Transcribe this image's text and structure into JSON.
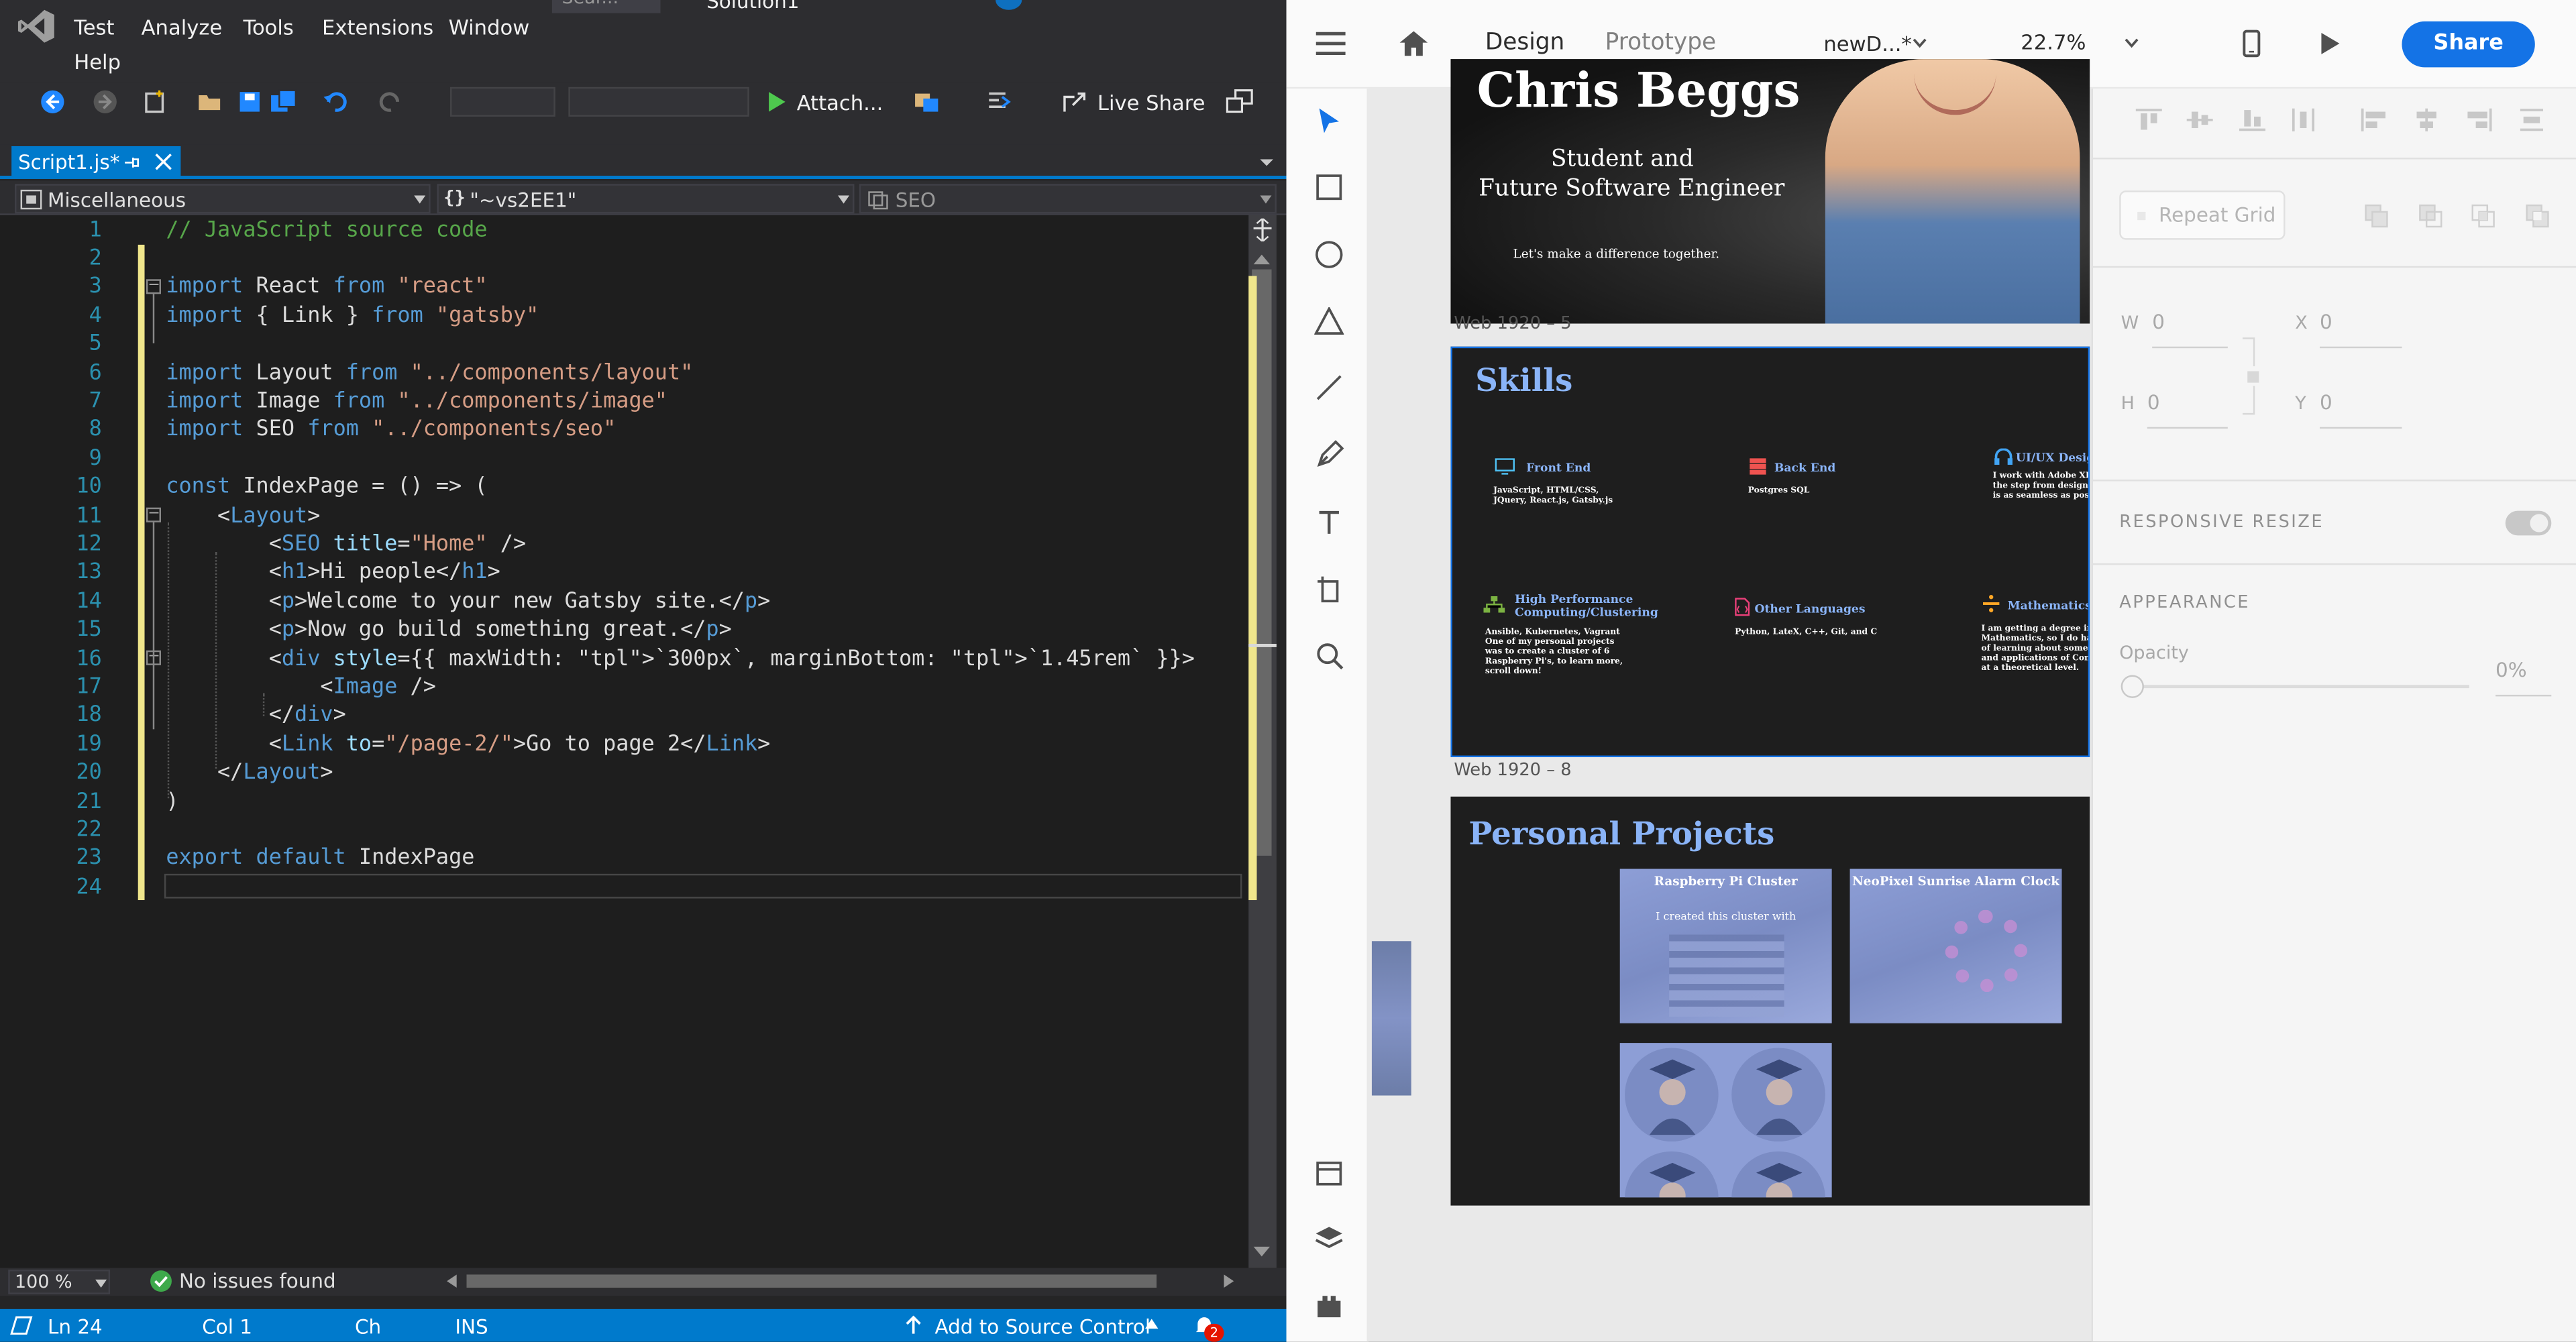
{
  "vs": {
    "menu": [
      "Test",
      "Analyze",
      "Tools",
      "Extensions",
      "Window",
      "Help"
    ],
    "search_placeholder": "Sear...",
    "solution_label": "Solution1",
    "attach_label": "Attach...",
    "live_share_label": "Live Share",
    "tab_title": "Script1.js*",
    "nav_project": "Miscellaneous",
    "nav_scope": "\"~vs2EE1\"",
    "nav_member": "SEO",
    "zoom": "100 %",
    "issues": "No issues found",
    "status": {
      "ln": "Ln 24",
      "col": "Col 1",
      "ch": "Ch",
      "ins": "INS",
      "source_control": "Add to Source Control",
      "notifications": "2"
    },
    "code_lines": [
      {
        "n": "1",
        "t": "// JavaScript source code"
      },
      {
        "n": "2",
        "t": ""
      },
      {
        "n": "3",
        "t": "import React from \"react\""
      },
      {
        "n": "4",
        "t": "import { Link } from \"gatsby\""
      },
      {
        "n": "5",
        "t": ""
      },
      {
        "n": "6",
        "t": "import Layout from \"../components/layout\""
      },
      {
        "n": "7",
        "t": "import Image from \"../components/image\""
      },
      {
        "n": "8",
        "t": "import SEO from \"../components/seo\""
      },
      {
        "n": "9",
        "t": ""
      },
      {
        "n": "10",
        "t": "const IndexPage = () => ("
      },
      {
        "n": "11",
        "t": "    <Layout>"
      },
      {
        "n": "12",
        "t": "        <SEO title=\"Home\" />"
      },
      {
        "n": "13",
        "t": "        <h1>Hi people</h1>"
      },
      {
        "n": "14",
        "t": "        <p>Welcome to your new Gatsby site.</p>"
      },
      {
        "n": "15",
        "t": "        <p>Now go build something great.</p>"
      },
      {
        "n": "16",
        "t": "        <div style={{ maxWidth: `300px`, marginBottom: `1.45rem` }}>"
      },
      {
        "n": "17",
        "t": "            <Image />"
      },
      {
        "n": "18",
        "t": "        </div>"
      },
      {
        "n": "19",
        "t": "        <Link to=\"/page-2/\">Go to page 2</Link>"
      },
      {
        "n": "20",
        "t": "    </Layout>"
      },
      {
        "n": "21",
        "t": ")"
      },
      {
        "n": "22",
        "t": ""
      },
      {
        "n": "23",
        "t": "export default IndexPage"
      },
      {
        "n": "24",
        "t": ""
      }
    ]
  },
  "xd": {
    "tabs": {
      "design": "Design",
      "prototype": "Prototype"
    },
    "doc_name": "newD...*",
    "zoom": "22.7%",
    "share": "Share",
    "hero": {
      "name": "Chris Beggs",
      "line1": "Student and",
      "line2": "Future Software Engineer",
      "tagline": "Let's make a difference together.",
      "artboard_label": "Web 1920 – 5"
    },
    "skills": {
      "title": "Skills",
      "artboard_label": "Web 1920 – 8",
      "items": [
        {
          "title": "Front End",
          "body": "JavaScript, HTML/CSS,\nJQuery, React.js, Gatsby.js",
          "color": "#4fc3f7"
        },
        {
          "title": "Back End",
          "body": "Postgres SQL",
          "color": "#ef5350"
        },
        {
          "title": "UI/UX Design",
          "body": "I work with Adobe XD u\nthe step from designing\nis as seamless as possib",
          "color": "#42a5f5"
        },
        {
          "title": "High Performance\nComputing/Clustering",
          "body": "Ansible, Kubernetes, Vagrant\nOne of my personal projects\nwas to create a cluster of 6\nRaspberry Pi's, to learn more,\nscroll down!",
          "color": "#7cb342"
        },
        {
          "title": "Other Languages",
          "body": "Python, LateX, C++, Git, and C",
          "color": "#ec407a"
        },
        {
          "title": "Mathematics",
          "body": "I am getting a degree in Pu\nMathematics, so I do have\nof learning about some of\nand applications of Compu\nat a theoretical level.",
          "color": "#ffa726"
        }
      ]
    },
    "projects": {
      "title": "Personal Projects",
      "cards": [
        {
          "title": "Raspberry Pi Cluster",
          "sub": "I created this cluster with"
        },
        {
          "title": "NeoPixel Sunrise Alarm Clock",
          "sub": ""
        }
      ]
    },
    "props": {
      "repeat_grid": "Repeat Grid",
      "w_label": "W",
      "w": "0",
      "x_label": "X",
      "x": "0",
      "h_label": "H",
      "h": "0",
      "y_label": "Y",
      "y": "0",
      "responsive": "RESPONSIVE RESIZE",
      "appearance": "APPEARANCE",
      "opacity_label": "Opacity",
      "opacity": "0%"
    }
  }
}
